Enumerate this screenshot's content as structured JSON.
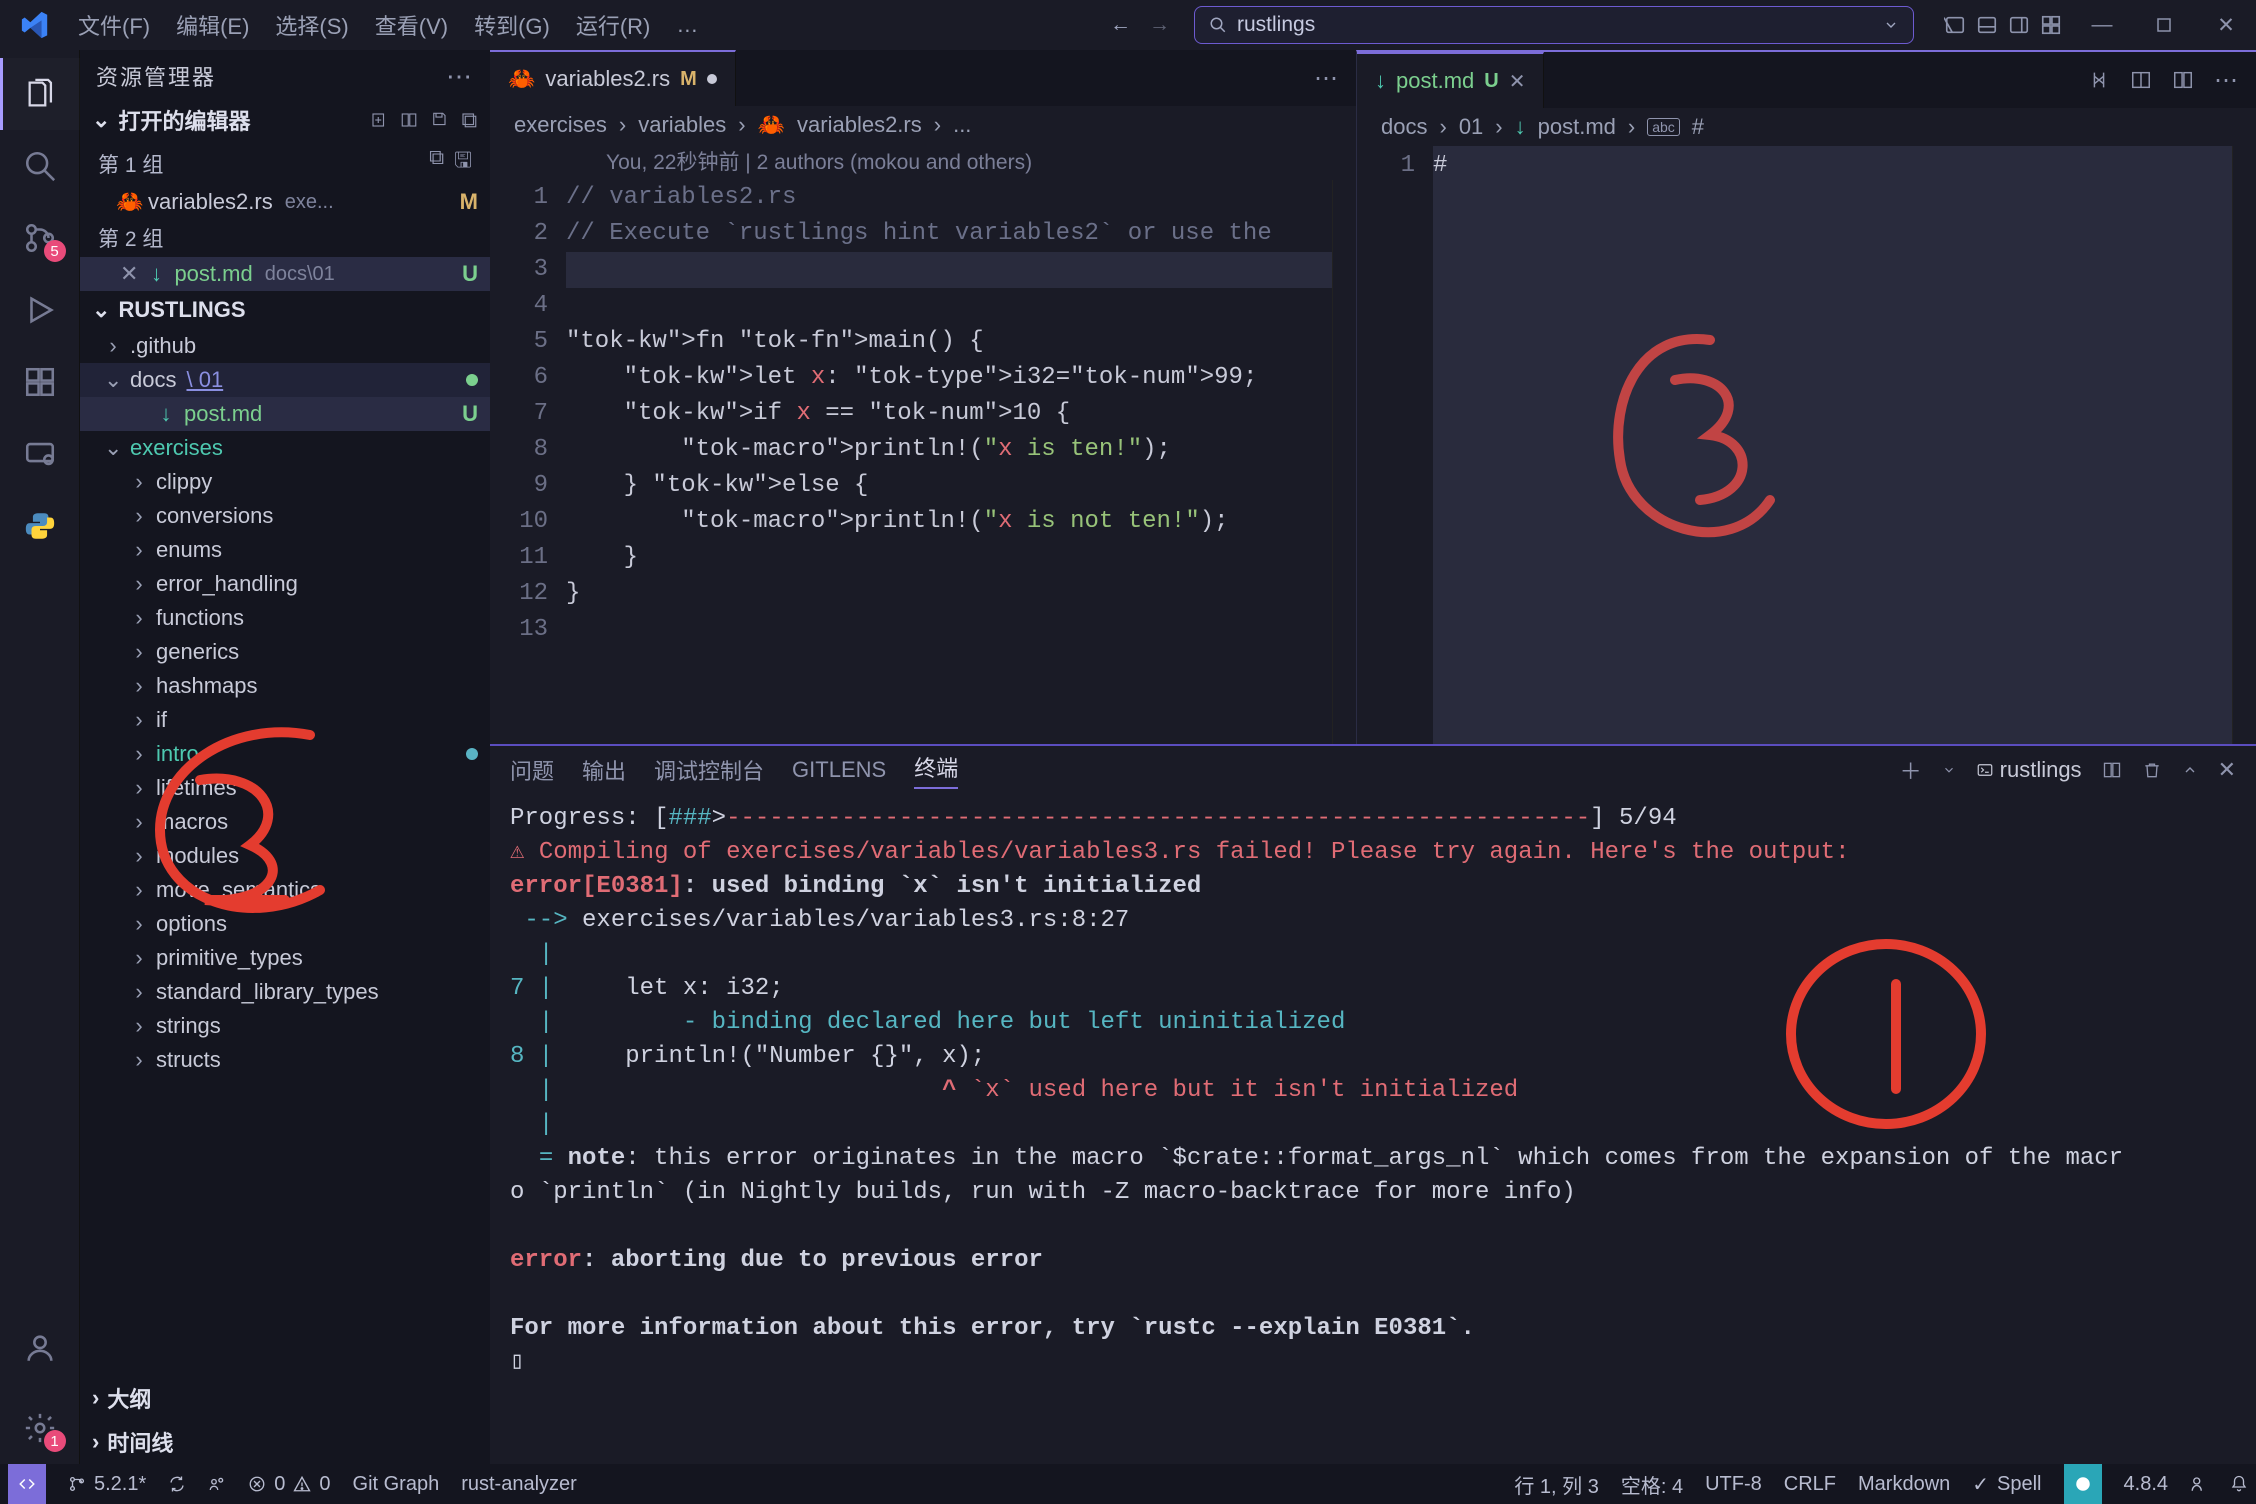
{
  "title_menu": [
    "文件(F)",
    "编辑(E)",
    "选择(S)",
    "查看(V)",
    "转到(G)",
    "运行(R)",
    "…"
  ],
  "search_placeholder": "rustlings",
  "activity_badges": {
    "scm": "5",
    "settings": "1"
  },
  "sidebar": {
    "header": "资源管理器",
    "open_editors": "打开的编辑器",
    "groups": [
      {
        "label": "第 1 组",
        "items": [
          {
            "icon": "rust",
            "name": "variables2.rs",
            "dim": "exe...",
            "status": "M"
          }
        ]
      },
      {
        "label": "第 2 组",
        "items": [
          {
            "icon": "md",
            "name": "post.md",
            "dim": "docs\\01",
            "status": "U",
            "closable": true
          }
        ]
      }
    ],
    "workspace": "RUSTLINGS",
    "tree": [
      {
        "type": "folder",
        "name": ".github",
        "depth": 0,
        "expanded": false
      },
      {
        "type": "folder",
        "name": "docs",
        "depth": 0,
        "expanded": true,
        "suffix": "\\ 01",
        "dot": "green",
        "selected": true
      },
      {
        "type": "file",
        "name": "post.md",
        "depth": 1,
        "status": "U",
        "icon": "md",
        "active": true
      },
      {
        "type": "folder",
        "name": "exercises",
        "depth": 0,
        "expanded": true,
        "accent": "teal"
      },
      {
        "type": "folder",
        "name": "clippy",
        "depth": 1
      },
      {
        "type": "folder",
        "name": "conversions",
        "depth": 1
      },
      {
        "type": "folder",
        "name": "enums",
        "depth": 1
      },
      {
        "type": "folder",
        "name": "error_handling",
        "depth": 1
      },
      {
        "type": "folder",
        "name": "functions",
        "depth": 1
      },
      {
        "type": "folder",
        "name": "generics",
        "depth": 1
      },
      {
        "type": "folder",
        "name": "hashmaps",
        "depth": 1
      },
      {
        "type": "folder",
        "name": "if",
        "depth": 1
      },
      {
        "type": "folder",
        "name": "intro",
        "depth": 1,
        "accent": "teal",
        "dot": "teal"
      },
      {
        "type": "folder",
        "name": "lifetimes",
        "depth": 1
      },
      {
        "type": "folder",
        "name": "macros",
        "depth": 1
      },
      {
        "type": "folder",
        "name": "modules",
        "depth": 1
      },
      {
        "type": "folder",
        "name": "move_semantics",
        "depth": 1
      },
      {
        "type": "folder",
        "name": "options",
        "depth": 1
      },
      {
        "type": "folder",
        "name": "primitive_types",
        "depth": 1
      },
      {
        "type": "folder",
        "name": "standard_library_types",
        "depth": 1
      },
      {
        "type": "folder",
        "name": "strings",
        "depth": 1
      },
      {
        "type": "folder",
        "name": "structs",
        "depth": 1
      }
    ],
    "outline": "大纲",
    "timeline": "时间线"
  },
  "editor_left": {
    "tab": {
      "name": "variables2.rs",
      "status": "M"
    },
    "crumbs": [
      "exercises",
      "variables",
      "variables2.rs",
      "..."
    ],
    "codelens": "You, 22秒钟前 | 2 authors (mokou and others)",
    "lines": [
      "// variables2.rs",
      "// Execute `rustlings hint variables2` or use the",
      "",
      "",
      "fn main() {",
      "    let x: i32=99;",
      "    if x == 10 {",
      "        println!(\"x is ten!\");",
      "    } else {",
      "        println!(\"x is not ten!\");",
      "    }",
      "}",
      ""
    ]
  },
  "editor_right": {
    "tab": {
      "name": "post.md",
      "status": "U"
    },
    "crumbs": [
      "docs",
      "01",
      "post.md",
      "#"
    ],
    "gutter": "1",
    "content": "# "
  },
  "panel": {
    "tabs": [
      "问题",
      "输出",
      "调试控制台",
      "GITLENS",
      "终端"
    ],
    "active": "终端",
    "terminal_label": "rustlings",
    "lines": [
      {
        "t": "plain",
        "s": "Progress: [###>------------------------------------------------------------] 5/94"
      },
      {
        "t": "warn",
        "s": "⚠ Compiling of exercises/variables/variables3.rs failed! Please try again. Here's the output:"
      },
      {
        "t": "err",
        "s": "error[E0381]: used binding `x` isn't initialized"
      },
      {
        "t": "loc",
        "s": " --> exercises/variables/variables3.rs:8:27"
      },
      {
        "t": "pipe",
        "s": "  |"
      },
      {
        "t": "num",
        "s": "7 |     let x: i32;"
      },
      {
        "t": "note",
        "s": "  |         - binding declared here but left uninitialized"
      },
      {
        "t": "num",
        "s": "8 |     println!(\"Number {}\", x);"
      },
      {
        "t": "caret",
        "s": "  |                           ^ `x` used here but it isn't initialized"
      },
      {
        "t": "pipe",
        "s": "  |"
      },
      {
        "t": "eqnote",
        "s": "  = note: this error originates in the macro `$crate::format_args_nl` which comes from the expansion of the macro `println` (in Nightly builds, run with -Z macro-backtrace for more info)"
      },
      {
        "t": "blank",
        "s": ""
      },
      {
        "t": "err2",
        "s": "error: aborting due to previous error"
      },
      {
        "t": "blank",
        "s": ""
      },
      {
        "t": "info",
        "s": "For more information about this error, try `rustc --explain E0381`."
      },
      {
        "t": "cursor",
        "s": "▯"
      }
    ]
  },
  "status_bar": {
    "left": [
      "5.2.1*",
      "",
      "",
      "0",
      "0",
      "Git Graph",
      "rust-analyzer"
    ],
    "right": [
      "行 1, 列 3",
      "空格: 4",
      "UTF-8",
      "CRLF",
      "Markdown",
      "Spell",
      "",
      "4.8.4",
      "",
      ""
    ],
    "errors": "0",
    "warnings": "0",
    "branch": "5.2.1*",
    "line_col": "行 1, 列 3",
    "spaces": "空格: 4",
    "encoding": "UTF-8",
    "eol": "CRLF",
    "lang": "Markdown",
    "spell": "Spell",
    "ver": "4.8.4"
  }
}
